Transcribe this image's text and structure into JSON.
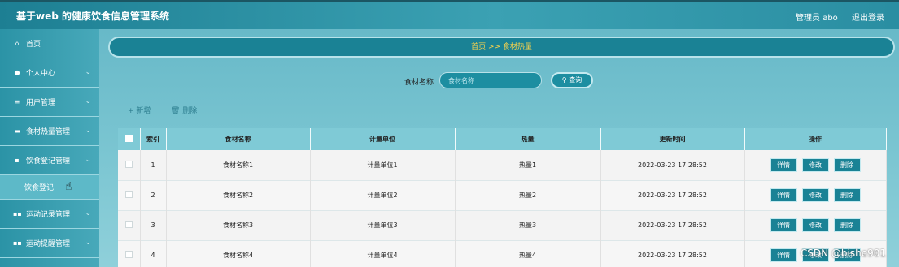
{
  "header": {
    "title": "基于web 的健康饮食信息管理系统",
    "user": "管理员 abo",
    "logout": "退出登录"
  },
  "sidebar": {
    "items": [
      {
        "icon": "home-icon",
        "glyph": "⌂",
        "label": "首页",
        "chevron": false
      },
      {
        "icon": "user-icon",
        "glyph": "●",
        "label": "个人中心",
        "chevron": true
      },
      {
        "icon": "list-icon",
        "glyph": "≡",
        "label": "用户管理",
        "chevron": true
      },
      {
        "icon": "chat-icon",
        "glyph": "▬",
        "label": "食材热量管理",
        "chevron": true
      },
      {
        "icon": "clipboard-icon",
        "glyph": "▪",
        "label": "饮食登记管理",
        "chevron": true
      }
    ],
    "sub_item": "饮食登记",
    "items_after": [
      {
        "icon": "grid-icon",
        "glyph": "▪▪",
        "label": "运动记录管理",
        "chevron": true
      },
      {
        "icon": "grid-icon",
        "glyph": "▪▪",
        "label": "运动提醒管理",
        "chevron": true
      }
    ]
  },
  "breadcrumb": "首页 >> 食材热量",
  "search": {
    "label": "食材名称",
    "placeholder": "食材名称",
    "button": "查询",
    "icon": "search-icon"
  },
  "actions": {
    "add": "+ 新增",
    "delete": "🗑 删除"
  },
  "table": {
    "headers": [
      "索引",
      "食材名称",
      "计量单位",
      "热量",
      "更新时间",
      "操作"
    ],
    "rows": [
      [
        "1",
        "食材名称1",
        "计量单位1",
        "热量1",
        "2022-03-23 17:28:52"
      ],
      [
        "2",
        "食材名称2",
        "计量单位2",
        "热量2",
        "2022-03-23 17:28:52"
      ],
      [
        "3",
        "食材名称3",
        "计量单位3",
        "热量3",
        "2022-03-23 17:28:52"
      ],
      [
        "4",
        "食材名称4",
        "计量单位4",
        "热量4",
        "2022-03-23 17:28:52"
      ]
    ],
    "ops": [
      "详情",
      "修改",
      "删除"
    ]
  },
  "watermark": "CSDN @bishe901"
}
